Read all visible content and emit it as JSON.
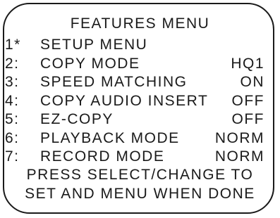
{
  "menu": {
    "title": "FEATURES MENU",
    "items": [
      {
        "number": "1*",
        "label": "SETUP MENU",
        "value": ""
      },
      {
        "number": "2:",
        "label": "COPY MODE",
        "value": "HQ1"
      },
      {
        "number": "3:",
        "label": "SPEED MATCHING",
        "value": "ON"
      },
      {
        "number": "4:",
        "label": "COPY AUDIO INSERT",
        "value": "OFF"
      },
      {
        "number": "5:",
        "label": "EZ-COPY",
        "value": "OFF"
      },
      {
        "number": "6:",
        "label": "PLAYBACK MODE",
        "value": "NORM"
      },
      {
        "number": "7:",
        "label": "RECORD MODE",
        "value": "NORM"
      }
    ],
    "instructions": {
      "line1": "PRESS SELECT/CHANGE TO",
      "line2": "SET AND MENU WHEN DONE"
    }
  }
}
